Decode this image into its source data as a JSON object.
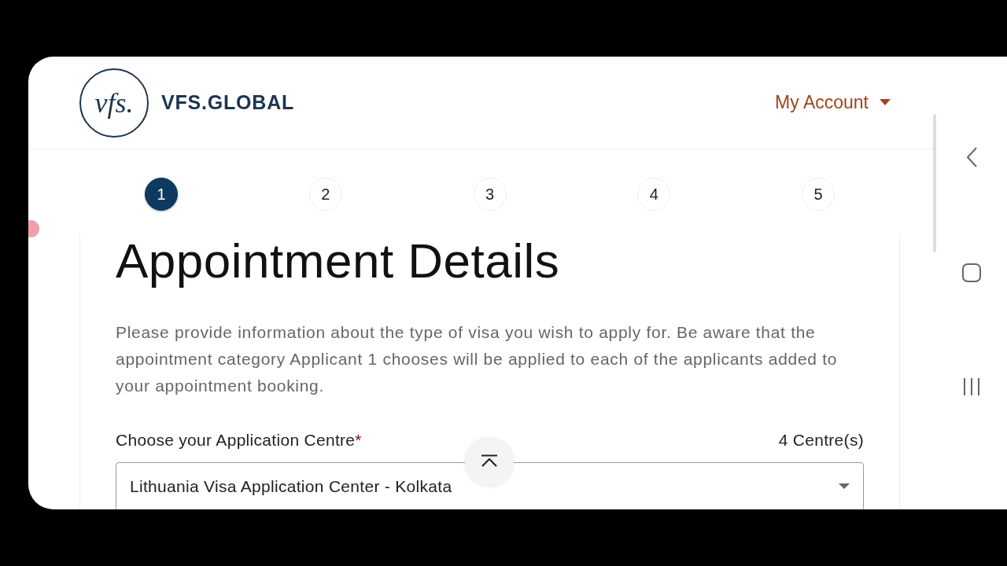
{
  "header": {
    "logo_mark": "vfs.",
    "logo_text": "VFS.GLOBAL",
    "account_menu": "My Account"
  },
  "steps": [
    {
      "label": "1",
      "selected": true
    },
    {
      "label": "2",
      "selected": false
    },
    {
      "label": "3",
      "selected": false
    },
    {
      "label": "4",
      "selected": false
    },
    {
      "label": "5",
      "selected": false
    }
  ],
  "form": {
    "title": "Appointment Details",
    "intro": "Please provide information about the type of visa you wish to apply for. Be aware that the appointment category Applicant 1 chooses will be applied to each of the applicants added to your appointment booking.",
    "centre_label": "Choose your Application Centre",
    "required_mark": "*",
    "centre_count": "4 Centre(s)",
    "centre_value": "Lithuania Visa Application Center - Kolkata"
  }
}
